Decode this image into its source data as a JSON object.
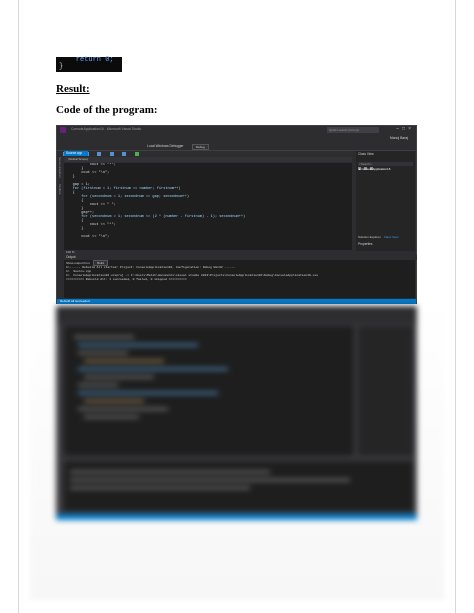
{
  "document": {
    "code_snippet": {
      "line1": "    return 0;",
      "line2": "}"
    },
    "result_heading": "Result:",
    "code_heading": "Code of the program:"
  },
  "ide": {
    "title": "ConsoleApplication16 - Microsoft Visual Studio",
    "quick_launch": "Quick Launch (Ctrl+Q)",
    "user": "Manoj Baraj",
    "menu": [
      "FILE",
      "EDIT",
      "VIEW",
      "PROJECT",
      "BUILD",
      "DEBUG",
      "TEAM",
      "TOOLS",
      "TEST",
      "ARCHITECTURE",
      "ANALYZE",
      "WINDOW",
      "HELP"
    ],
    "toolbar": {
      "debugger_label": "Local Windows Debugger",
      "config": "Debug"
    },
    "left_strip_labels": [
      "Server Explorer",
      "Toolbox"
    ],
    "editor_tab": "Source.cpp",
    "nav_scope": "(Global Scope)",
    "code_lines": [
      "            cout << \"*\";",
      "        }",
      "        cout << \"\\n\";",
      "    }",
      "",
      "    gap = 1;",
      "    for (firstnum = 1; firstnum <= number; firstnum++)",
      "    {",
      "        for (secondnum = 1; secondnum <= gap; secondnum++)",
      "        {",
      "            cout << \" \";",
      "        }",
      "        gap++;",
      "        for (secondnum = 1; secondnum <= (2 * (number - firstnum) - 1); secondnum++)",
      "        {",
      "            cout << \"*\";",
      "        }",
      "",
      "        cout << \"\\n\";"
    ],
    "zoom": "100 %",
    "solution_explorer": {
      "title": "Class View",
      "search": "<Search>",
      "item": "▸ ConsoleApplication16",
      "tabs": [
        "Solution Explorer",
        "Class View"
      ],
      "properties": "Properties"
    },
    "output": {
      "title": "Output",
      "show_from_label": "Show output from:",
      "show_from_value": "Build",
      "lines": [
        "1>------ Rebuild All started: Project: ConsoleApplication16, Configuration: Debug Win32 ------",
        "1>  Source.cpp",
        "1>  ConsoleApplication16.vcxproj -> C:\\Users\\Malik\\documents\\visual studio 2013\\Projects\\ConsoleApplication16\\Debug\\ConsoleApplication16.exe",
        "========== Rebuild All: 1 succeeded, 0 failed, 0 skipped =========="
      ]
    },
    "status": "Rebuild All succeeded"
  }
}
